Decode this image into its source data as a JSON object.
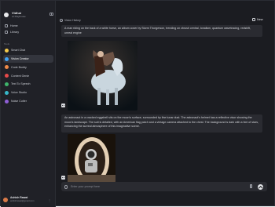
{
  "brand": {
    "name": "Vidhai",
    "tagline": "AI Playhouse"
  },
  "nav": [
    {
      "label": "Home",
      "icon": "home-icon"
    },
    {
      "label": "Library",
      "icon": "library-icon"
    }
  ],
  "tools_section_label": "Tools",
  "tools": [
    {
      "label": "Smart Chat",
      "color": "#f2c94c",
      "active": false
    },
    {
      "label": "Vision Creator",
      "color": "#3fa3f5",
      "active": true
    },
    {
      "label": "Code Buddy",
      "color": "#ef8a47",
      "active": false
    },
    {
      "label": "Content Genie",
      "color": "#e64a4a",
      "active": false
    },
    {
      "label": "Text To Speech",
      "color": "#3fb46b",
      "active": false
    },
    {
      "label": "Voice Studio",
      "color": "#37b8c9",
      "active": false
    },
    {
      "label": "Noise Cutter",
      "color": "#8f5fd6",
      "active": false
    }
  ],
  "user": {
    "name": "Ashish Rawat",
    "email": "ashishrawat@gmail.com"
  },
  "header": {
    "history_label": "Vision History",
    "new_label": "New"
  },
  "messages": [
    {
      "prompt": "A man riding on the back of a white horse, an album cover by Storm Thorgerson, trending on zbrush central, tonalism, quantum wavetracing, redshift, unreal engine"
    },
    {
      "prompt": "An astronaut in a cracked eggshell sits on the moon's surface, surrounded by fine lunar dust. The astronaut's helmet has a reflective visor showing the moon's landscape. The suit is detailed, with an American flag patch and a vintage camera attached to the chest. The background is dark with a hint of stars, enhancing the surreal atmosphere of this imaginative scene."
    }
  ],
  "composer": {
    "placeholder": "Enter your prompt here"
  },
  "colors": {
    "accent_active": "#33353d",
    "background": "#1b1c21",
    "sidebar": "#202127"
  }
}
